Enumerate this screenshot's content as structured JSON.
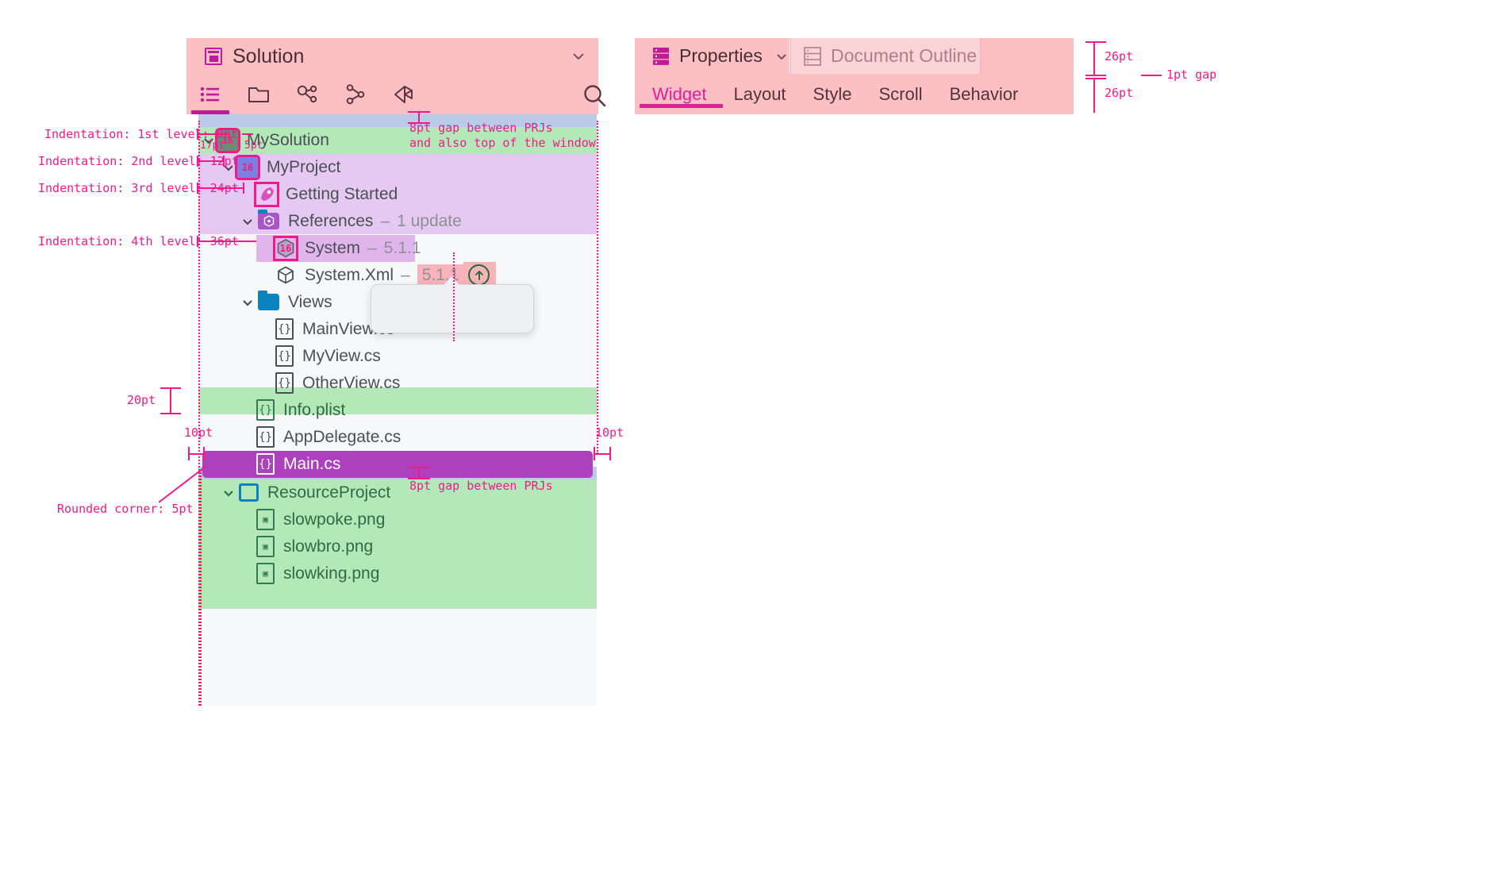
{
  "solution_panel": {
    "title": "Solution",
    "title_icon": "solution-panel-icon",
    "collapse_icon": "chevron-down-icon",
    "toolbar": [
      {
        "name": "list-view-icon",
        "label": ""
      },
      {
        "name": "folder-view-icon",
        "label": ""
      },
      {
        "name": "class-view-icon",
        "label": ""
      },
      {
        "name": "git-branch-icon",
        "label": ""
      },
      {
        "name": "unity-view-icon",
        "label": ""
      }
    ],
    "search_icon": "search-icon"
  },
  "tree": [
    {
      "label": "MySolution",
      "icon": "solution-icon",
      "icon_size": "16",
      "level": 1,
      "chevron": "expanded",
      "band": "green",
      "marked": true
    },
    {
      "label": "MyProject",
      "icon": "project-icon",
      "icon_size": "16",
      "level": 2,
      "chevron": "expanded",
      "band": "lilac",
      "marked": true
    },
    {
      "label": "Getting Started",
      "icon": "rocket-icon",
      "icon_size": "16",
      "level": 3,
      "chevron": "none",
      "band": "lilac",
      "marked": true
    },
    {
      "label": "References",
      "suffix_dash": "–",
      "suffix": "1 update",
      "icon": "references-folder-icon",
      "level": 3,
      "chevron": "expanded",
      "band": "none",
      "marked": false
    },
    {
      "label": "System",
      "suffix_dash": "–",
      "suffix": "5.1.1",
      "icon": "package-icon",
      "icon_size": "16",
      "level": 4,
      "chevron": "none",
      "band": "lilac",
      "marked": true
    },
    {
      "label": "System.Xml",
      "suffix_dash": "–",
      "suffix": "5.1.1",
      "icon": "package-outline-icon",
      "level": 4,
      "chevron": "none",
      "band": "none",
      "version_highlight": true,
      "update_badge": "↑"
    },
    {
      "label": "Views",
      "icon": "folder-icon",
      "level": 4,
      "chevron": "expanded",
      "band": "none"
    },
    {
      "label": "MainView.cs",
      "icon": "cs-file-icon",
      "level": 5,
      "chevron": "none",
      "band": "none"
    },
    {
      "label": "MyView.cs",
      "icon": "cs-file-icon",
      "level": 5,
      "chevron": "none",
      "band": "none"
    },
    {
      "label": "OtherView.cs",
      "icon": "cs-file-icon",
      "level": 5,
      "chevron": "none",
      "band": "none"
    },
    {
      "label": "Info.plist",
      "icon": "plist-file-icon",
      "level": 4,
      "chevron": "none",
      "band": "green"
    },
    {
      "label": "AppDelegate.cs",
      "icon": "cs-file-icon",
      "level": 4,
      "chevron": "none",
      "band": "none"
    },
    {
      "label": "Main.cs",
      "icon": "cs-file-icon",
      "level": 4,
      "chevron": "none",
      "band": "none",
      "selected": true
    },
    {
      "label": "ResourceProject",
      "icon": "resource-project-icon",
      "level": 2,
      "chevron": "expanded",
      "band": "green"
    },
    {
      "label": "slowpoke.png",
      "icon": "image-file-icon",
      "level": 3,
      "chevron": "none",
      "band": "green"
    },
    {
      "label": "slowbro.png",
      "icon": "image-file-icon",
      "level": 3,
      "chevron": "none",
      "band": "green"
    },
    {
      "label": "slowking.png",
      "icon": "image-file-icon",
      "level": 3,
      "chevron": "none",
      "band": "green"
    }
  ],
  "properties_panel": {
    "tabs": [
      {
        "label": "Properties",
        "icon": "properties-icon",
        "active": true
      },
      {
        "label": "Document Outline",
        "icon": "document-outline-icon",
        "active": false
      }
    ],
    "subtabs": [
      {
        "label": "Widget",
        "selected": true
      },
      {
        "label": "Layout",
        "selected": false
      },
      {
        "label": "Style",
        "selected": false
      },
      {
        "label": "Scroll",
        "selected": false
      },
      {
        "label": "Behavior",
        "selected": false
      }
    ]
  },
  "annotations": {
    "indent_1": "Indentation: 1st level: 0pt",
    "indent_2": "Indentation: 2nd level: 12pt",
    "indent_3": "Indentation: 3rd level: 24pt",
    "indent_4": "Indentation: 4th level: 36pt",
    "chevron_width": "17pt",
    "icon_gap": "5pt",
    "prj_gap_top": "8pt gap between PRJs\nand also top of the window",
    "prj_gap_bottom": "8pt gap between PRJs",
    "row_height": "20pt",
    "inset_left": "10pt",
    "inset_right": "10pt",
    "rounded_corner": "Rounded corner: 5pt",
    "tabbar_height_1": "26pt",
    "tabbar_height_2": "26pt",
    "tab_gap": "1pt gap",
    "icon_size_badge": "16"
  },
  "colors": {
    "anno": "#f01a8d",
    "band_green": "#b5e8b9",
    "band_pink": "#fcc0c4",
    "band_blue": "#bacbe8",
    "band_lilac": "#dfb5ec",
    "selection": "#ad41bd",
    "accent": "#c2199b",
    "folder_blue": "#0a84c0"
  }
}
